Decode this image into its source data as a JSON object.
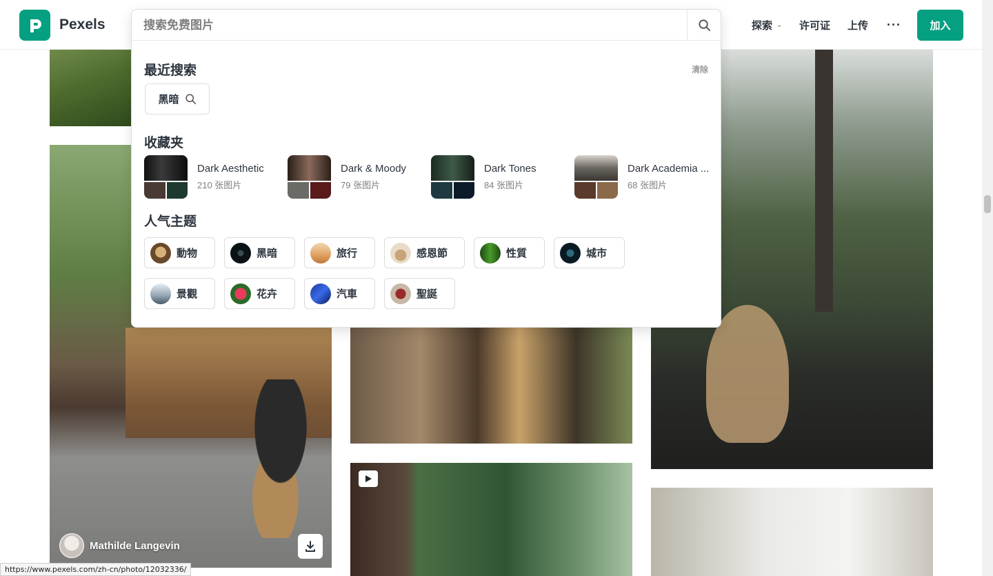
{
  "brand": {
    "name": "Pexels",
    "accent": "#05a081"
  },
  "nav": {
    "explore": "探索",
    "license": "许可证",
    "upload": "上传",
    "more": "···",
    "join": "加入"
  },
  "search": {
    "placeholder": "搜索免费图片",
    "icon": "search-icon"
  },
  "recent": {
    "title": "最近搜索",
    "clear": "清除",
    "items": [
      "黑暗"
    ]
  },
  "collections": {
    "title": "收藏夹",
    "items": [
      {
        "name": "Dark Aesthetic",
        "count": "210 张图片"
      },
      {
        "name": "Dark & Moody",
        "count": "79 张图片"
      },
      {
        "name": "Dark Tones",
        "count": "84 张图片"
      },
      {
        "name": "Dark Academia ...",
        "count": "68 张图片"
      }
    ]
  },
  "topics": {
    "title": "人气主题",
    "items": [
      "動物",
      "黑暗",
      "旅行",
      "感恩節",
      "性質",
      "城市",
      "景觀",
      "花卉",
      "汽車",
      "聖誕"
    ]
  },
  "photo": {
    "author": "Mathilde Langevin"
  },
  "status_url": "https://www.pexels.com/zh-cn/photo/12032336/"
}
